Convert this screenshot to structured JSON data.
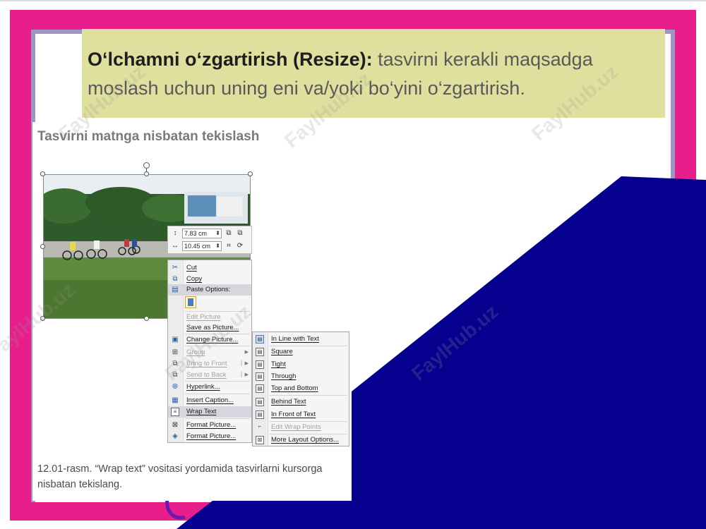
{
  "colors": {
    "frame_pink": "#e81e8c",
    "frame_lavender": "#9c96c6",
    "navy_shape": "#05008e",
    "highlight_bg": "#dfe09d"
  },
  "definition": {
    "term": "O‘lchamni o‘zgartirish (Resize):",
    "text": " tasvirni kerakli maqsadga moslash uchun uning eni va/yoki bo‘yini o‘zgartirish."
  },
  "doc": {
    "heading": "Tasvirni matnga nisbatan tekislash",
    "caption": "12.01-rasm. “Wrap text” vositasi yordamida tasvirlarni kursorga nisbatan tekislang."
  },
  "minibar": {
    "height_value": "7.83 cm",
    "width_value": "10.45 cm"
  },
  "context_menu": [
    {
      "label": "Cut",
      "icon": "scissors-icon",
      "disabled": false
    },
    {
      "label": "Copy",
      "icon": "copy-icon",
      "disabled": false
    },
    {
      "label": "Paste Options:",
      "icon": "paste-icon",
      "disabled": false
    },
    {
      "label": "Edit Picture",
      "icon": "",
      "disabled": true
    },
    {
      "label": "Save as Picture...",
      "icon": "",
      "disabled": false
    },
    {
      "label": "Change Picture...",
      "icon": "change-picture-icon",
      "disabled": false
    },
    {
      "label": "Group",
      "icon": "group-icon",
      "disabled": true
    },
    {
      "label": "Bring to Front",
      "icon": "bring-front-icon",
      "disabled": true
    },
    {
      "label": "Send to Back",
      "icon": "send-back-icon",
      "disabled": true
    },
    {
      "label": "Hyperlink...",
      "icon": "hyperlink-icon",
      "disabled": false
    },
    {
      "label": "Insert Caption...",
      "icon": "caption-icon",
      "disabled": false
    },
    {
      "label": "Wrap Text",
      "icon": "wrap-text-icon",
      "disabled": false
    },
    {
      "label": "Format Picture...",
      "icon": "format-picture-icon",
      "disabled": false
    },
    {
      "label": "Format Picture...",
      "icon": "format-shape-icon",
      "disabled": false
    }
  ],
  "wrap_submenu": [
    {
      "label": "In Line with Text",
      "icon": "inline-icon",
      "disabled": false
    },
    {
      "label": "Square",
      "icon": "square-wrap-icon",
      "disabled": false
    },
    {
      "label": "Tight",
      "icon": "tight-wrap-icon",
      "disabled": false
    },
    {
      "label": "Through",
      "icon": "through-wrap-icon",
      "disabled": false
    },
    {
      "label": "Top and Bottom",
      "icon": "top-bottom-icon",
      "disabled": false
    },
    {
      "label": "Behind Text",
      "icon": "behind-text-icon",
      "disabled": false
    },
    {
      "label": "In Front of Text",
      "icon": "front-text-icon",
      "disabled": false
    },
    {
      "label": "Edit Wrap Points",
      "icon": "edit-points-icon",
      "disabled": true
    },
    {
      "label": "More Layout Options...",
      "icon": "layout-options-icon",
      "disabled": false
    }
  ],
  "watermark": "FaylHub.uz"
}
